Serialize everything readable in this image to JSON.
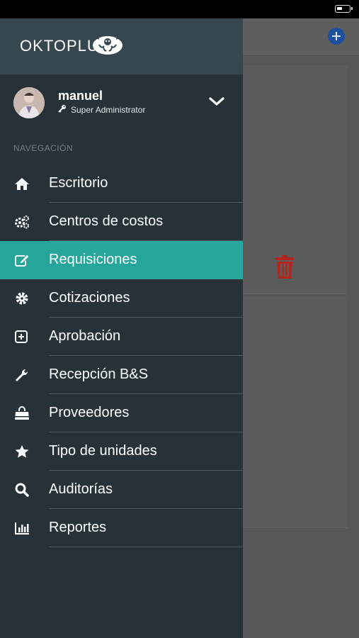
{
  "brand": {
    "logo_text": "OKTOPLUS"
  },
  "user": {
    "name": "manuel",
    "role": "Super Administrator"
  },
  "section": {
    "label": "NAVEGACIÓN"
  },
  "nav": {
    "items": [
      {
        "label": "Escritorio",
        "icon": "home-icon"
      },
      {
        "label": "Centros de costos",
        "icon": "gears-icon"
      },
      {
        "label": "Requisiciones",
        "icon": "edit-icon",
        "active": true
      },
      {
        "label": "Cotizaciones",
        "icon": "gear-icon"
      },
      {
        "label": "Aprobación",
        "icon": "plus-square-icon"
      },
      {
        "label": "Recepción B&S",
        "icon": "wrench-icon"
      },
      {
        "label": "Proveedores",
        "icon": "shopping-bag-icon"
      },
      {
        "label": "Tipo de unidades",
        "icon": "star-icon"
      },
      {
        "label": "Auditorías",
        "icon": "search-icon"
      },
      {
        "label": "Reportes",
        "icon": "bar-chart-icon"
      }
    ]
  },
  "colors": {
    "drawer_bg": "#263238",
    "brand_bar_bg": "#37474f",
    "active_bg": "#26a69a",
    "trash": "#c62828",
    "add_button": "#1e4f9c"
  }
}
